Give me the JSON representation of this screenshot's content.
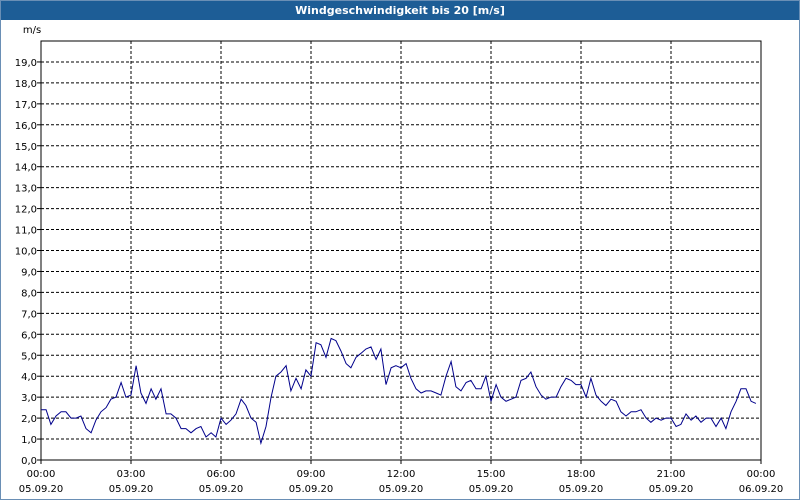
{
  "window": {
    "title": "Windgeschwindigkeit bis 20 [m/s]"
  },
  "chart_data": {
    "type": "line",
    "title": "Windgeschwindigkeit bis 20 [m/s]",
    "ylabel": "m/s",
    "xlabel": "",
    "ylim": [
      0,
      20
    ],
    "xlim_hours": [
      0,
      24
    ],
    "grid": true,
    "line_color": "#00008b",
    "y_ticks": [
      "0,0",
      "1,0",
      "2,0",
      "3,0",
      "4,0",
      "5,0",
      "6,0",
      "7,0",
      "8,0",
      "9,0",
      "10,0",
      "11,0",
      "12,0",
      "13,0",
      "14,0",
      "15,0",
      "16,0",
      "17,0",
      "18,0",
      "19,0"
    ],
    "x_ticks": [
      {
        "time": "00:00",
        "date": "05.09.20"
      },
      {
        "time": "03:00",
        "date": "05.09.20"
      },
      {
        "time": "06:00",
        "date": "05.09.20"
      },
      {
        "time": "09:00",
        "date": "05.09.20"
      },
      {
        "time": "12:00",
        "date": "05.09.20"
      },
      {
        "time": "15:00",
        "date": "05.09.20"
      },
      {
        "time": "18:00",
        "date": "05.09.20"
      },
      {
        "time": "21:00",
        "date": "05.09.20"
      },
      {
        "time": "00:00",
        "date": "06.09.20"
      }
    ],
    "series": [
      {
        "x": [
          0.0,
          0.17,
          0.33,
          0.5,
          0.67,
          0.83,
          1.0,
          1.17,
          1.33,
          1.5,
          1.67,
          1.83,
          2.0,
          2.17,
          2.33,
          2.5,
          2.67,
          2.83,
          3.0,
          3.17,
          3.33,
          3.5,
          3.67,
          3.83,
          4.0,
          4.17,
          4.33,
          4.5,
          4.67,
          4.83,
          5.0,
          5.17,
          5.33,
          5.5,
          5.67,
          5.83,
          6.0,
          6.17,
          6.33,
          6.5,
          6.67,
          6.83,
          7.0,
          7.17,
          7.33,
          7.5,
          7.67,
          7.83,
          8.0,
          8.17,
          8.33,
          8.5,
          8.67,
          8.83,
          9.0,
          9.17,
          9.33,
          9.5,
          9.67,
          9.83,
          10.0,
          10.17,
          10.33,
          10.5,
          10.67,
          10.83,
          11.0,
          11.17,
          11.33,
          11.5,
          11.67,
          11.83,
          12.0,
          12.17,
          12.33,
          12.5,
          12.67,
          12.83,
          13.0,
          13.17,
          13.33,
          13.5,
          13.67,
          13.83,
          14.0,
          14.17,
          14.33,
          14.5,
          14.67,
          14.83,
          15.0,
          15.17,
          15.33,
          15.5,
          15.67,
          15.83,
          16.0,
          16.17,
          16.33,
          16.5,
          16.67,
          16.83,
          17.0,
          17.17,
          17.33,
          17.5,
          17.67,
          17.83,
          18.0,
          18.17,
          18.33,
          18.5,
          18.67,
          18.83,
          19.0,
          19.17,
          19.33,
          19.5,
          19.67,
          19.83,
          20.0,
          20.17,
          20.33,
          20.5,
          20.67,
          20.83,
          21.0,
          21.17,
          21.33,
          21.5,
          21.67,
          21.83,
          22.0,
          22.17,
          22.33,
          22.5,
          22.67,
          22.83,
          23.0,
          23.17,
          23.33,
          23.5,
          23.67,
          23.83
        ],
        "values": [
          2.4,
          2.4,
          1.7,
          2.1,
          2.3,
          2.3,
          2.0,
          2.0,
          2.1,
          1.5,
          1.3,
          1.9,
          2.3,
          2.5,
          2.9,
          3.0,
          3.7,
          3.0,
          3.1,
          4.5,
          3.2,
          2.7,
          3.4,
          2.9,
          3.4,
          2.2,
          2.2,
          2.0,
          1.5,
          1.5,
          1.3,
          1.5,
          1.6,
          1.1,
          1.3,
          1.1,
          2.0,
          1.7,
          1.9,
          2.2,
          2.9,
          2.6,
          2.0,
          1.8,
          0.8,
          1.6,
          3.0,
          4.0,
          4.2,
          4.5,
          3.3,
          3.9,
          3.4,
          4.3,
          4.0,
          5.6,
          5.5,
          4.9,
          5.8,
          5.7,
          5.2,
          4.6,
          4.4,
          4.9,
          5.1,
          5.3,
          5.4,
          4.8,
          5.3,
          3.6,
          4.4,
          4.5,
          4.4,
          4.6,
          3.9,
          3.4,
          3.2,
          3.3,
          3.3,
          3.2,
          3.1,
          4.0,
          4.7,
          3.5,
          3.3,
          3.7,
          3.8,
          3.4,
          3.4,
          4.0,
          2.8,
          3.6,
          3.0,
          2.8,
          2.9,
          3.0,
          3.8,
          3.9,
          4.2,
          3.5,
          3.1,
          2.9,
          3.0,
          3.0,
          3.5,
          3.9,
          3.8,
          3.6,
          3.6,
          3.0,
          3.9,
          3.1,
          2.8,
          2.6,
          2.9,
          2.8,
          2.3,
          2.1,
          2.3,
          2.3,
          2.4,
          2.0,
          1.8,
          2.0,
          1.9,
          2.0,
          2.0,
          1.6,
          1.7,
          2.2,
          1.9,
          2.1,
          1.8,
          2.0,
          2.0,
          1.6,
          2.0,
          1.5,
          2.3,
          2.8,
          3.4,
          3.4,
          2.8,
          2.7
        ]
      }
    ]
  }
}
